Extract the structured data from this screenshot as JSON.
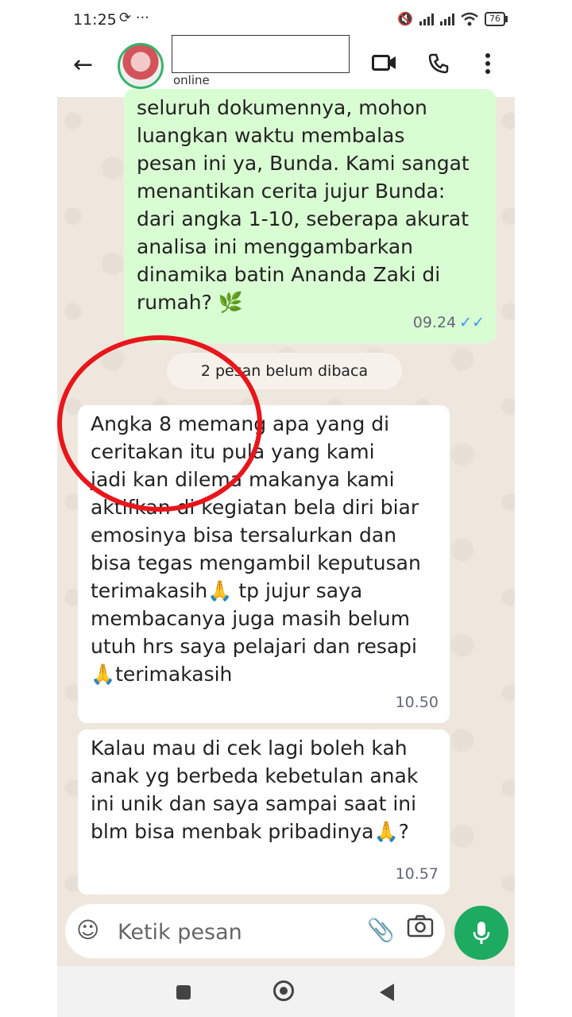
{
  "status_bar": {
    "time": "11:25",
    "left_icons": "⟳ ···",
    "battery": "76"
  },
  "header": {
    "status": "online"
  },
  "messages": [
    {
      "direction": "out",
      "text": "seluruh dokumennya, mohon\nluangkan waktu membalas\npesan ini ya, Bunda. Kami sangat\nmenantikan cerita jujur Bunda:\ndari angka 1-10, seberapa akurat\nanalisa ini menggambarkan\ndinamika batin Ananda Zaki di\nrumah? 🌿",
      "time": "09.24",
      "ticks": "✓✓"
    },
    {
      "direction": "in",
      "text": "Angka 8 memang apa yang di\nceritakan itu pula yang kami\njadi kan dilema makanya kami\naktifkan di kegiatan bela diri biar\nemosinya bisa tersalurkan dan\nbisa tegas mengambil keputusan\nterimakasih🙏  tp jujur saya\nmembacanya juga masih belum\nutuh hrs saya pelajari dan resapi\n🙏terimakasih",
      "time": "10.50"
    },
    {
      "direction": "in",
      "text": "Kalau mau di cek lagi boleh kah\nanak yg berbeda kebetulan anak\nini unik dan saya sampai saat ini\nblm bisa menbak pribadinya🙏?",
      "time": "10.57"
    }
  ],
  "unread_label": "2 pesan belum dibaca",
  "input": {
    "placeholder": "Ketik pesan"
  },
  "colors": {
    "accent": "#1daa61",
    "outgoing_bubble": "#d9fdd3",
    "annotation": "#e8161b",
    "ticks": "#3497f9"
  }
}
